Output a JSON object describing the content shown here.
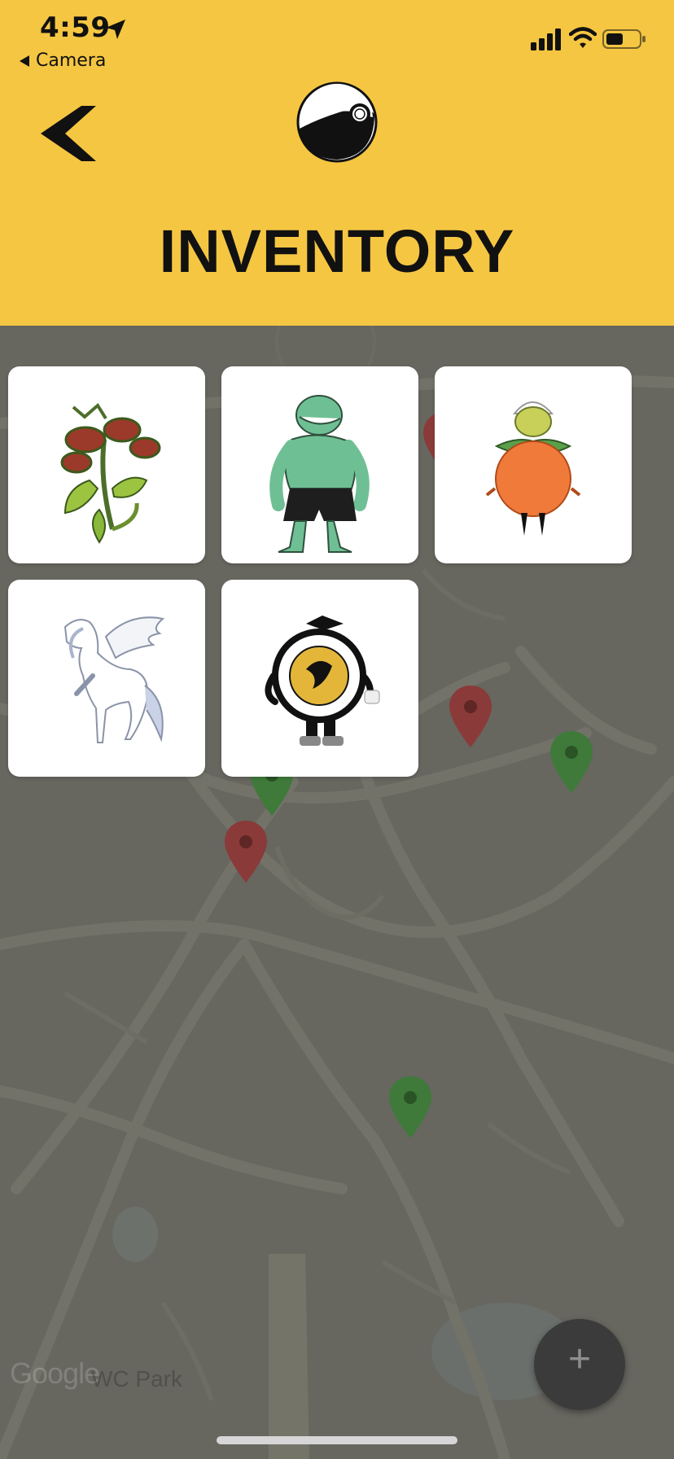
{
  "status_bar": {
    "time": "4:59",
    "back_app": "Camera"
  },
  "header": {
    "title": "INVENTORY",
    "back_icon": "chevron-left-icon",
    "logo_icon": "capture-ball-icon"
  },
  "inventory": {
    "items": [
      {
        "name": "venus-flytrap-creature"
      },
      {
        "name": "green-lizard-monster"
      },
      {
        "name": "orange-fruit-creature"
      },
      {
        "name": "white-pegasus"
      },
      {
        "name": "ucf-seal-mascot"
      }
    ]
  },
  "map": {
    "attribution": "Google",
    "place_label": "WC Park",
    "pins": [
      {
        "color": "#8a3a38"
      },
      {
        "color": "#8a3a38"
      },
      {
        "color": "#3f7a3a"
      },
      {
        "color": "#3f7a3a"
      },
      {
        "color": "#8a3a38"
      },
      {
        "color": "#3f7a3a"
      }
    ]
  },
  "fab": {
    "label": "+"
  },
  "colors": {
    "header": "#f5c642",
    "map": "#67665f",
    "pin_red": "#8a3a38",
    "pin_green": "#3f7a3a"
  }
}
